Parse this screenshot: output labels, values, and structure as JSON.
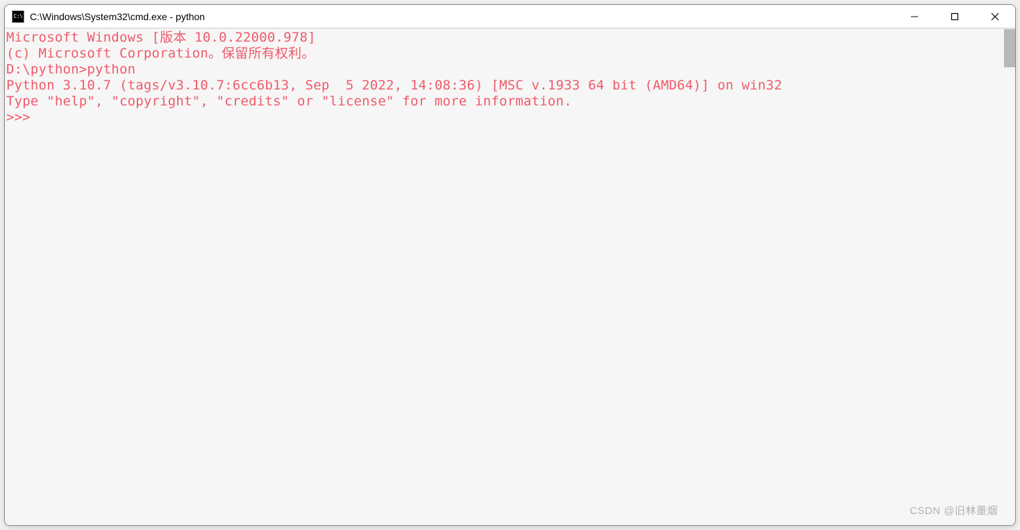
{
  "window": {
    "icon_text": "C:\\",
    "title": "C:\\Windows\\System32\\cmd.exe - python"
  },
  "terminal": {
    "lines": [
      "Microsoft Windows [版本 10.0.22000.978]",
      "(c) Microsoft Corporation。保留所有权利。",
      "",
      "D:\\python>python",
      "Python 3.10.7 (tags/v3.10.7:6cc6b13, Sep  5 2022, 14:08:36) [MSC v.1933 64 bit (AMD64)] on win32",
      "Type \"help\", \"copyright\", \"credits\" or \"license\" for more information.",
      ">>>"
    ]
  },
  "watermark": "CSDN @旧林墨烟"
}
